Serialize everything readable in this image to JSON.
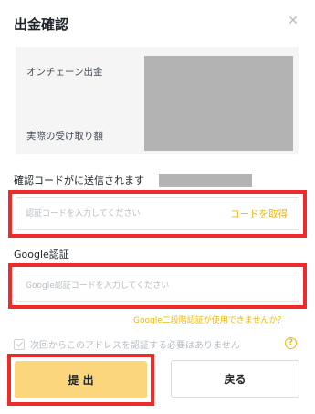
{
  "dialog": {
    "title": "出金確認",
    "close_icon": "close-icon"
  },
  "summary": {
    "onchain_label": "オンチェーン出金",
    "received_label": "実際の受け取り額"
  },
  "email_code": {
    "label": "確認コードがに送信されます",
    "placeholder": "認証コードを入力してください",
    "value": "",
    "get_code_label": "コードを取得"
  },
  "google_auth": {
    "label": "Google認証",
    "placeholder": "Google認証コードを入力してください",
    "value": "",
    "help_link": "Google二段階認証が使用できませんか？"
  },
  "remember": {
    "checked": true,
    "label": "次回からこのアドレスを認証する必要はありません",
    "help_icon": "question-circle-icon"
  },
  "buttons": {
    "submit_label": "提 出",
    "back_label": "戻る"
  },
  "colors": {
    "accent": "#f0b90b",
    "submit_bg": "#fbd67d",
    "highlight": "#ee2b2b",
    "redaction": "#b3b3b3"
  }
}
